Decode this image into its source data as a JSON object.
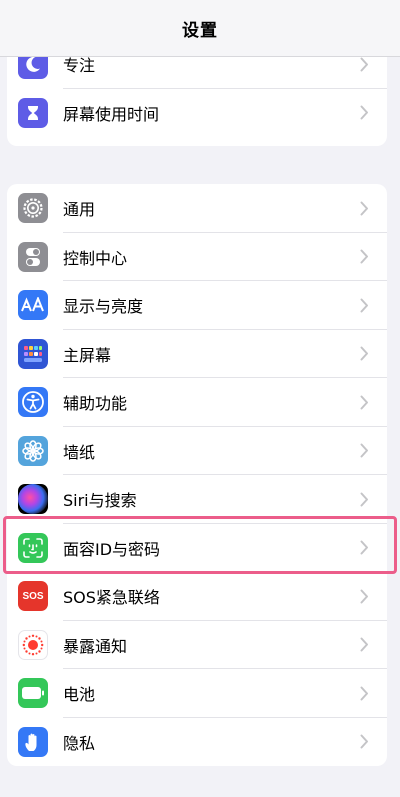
{
  "nav": {
    "title": "设置"
  },
  "group1": {
    "items": [
      {
        "label": "专注",
        "icon": "moon-icon",
        "color": "#5e5ce6"
      },
      {
        "label": "屏幕使用时间",
        "icon": "hourglass-icon",
        "color": "#5e5ce6"
      }
    ]
  },
  "group2": {
    "items": [
      {
        "label": "通用",
        "icon": "gear-icon",
        "color": "#8e8e93"
      },
      {
        "label": "控制中心",
        "icon": "toggles-icon",
        "color": "#8e8e93"
      },
      {
        "label": "显示与亮度",
        "icon": "text-size-icon",
        "color": "#3478f6"
      },
      {
        "label": "主屏幕",
        "icon": "home-screen-grid-icon",
        "color": "#3478f6"
      },
      {
        "label": "辅助功能",
        "icon": "accessibility-icon",
        "color": "#3478f6"
      },
      {
        "label": "墙纸",
        "icon": "flower-icon",
        "color": "#54a4dc"
      },
      {
        "label": "Siri与搜索",
        "icon": "siri-icon",
        "color": "#000000"
      },
      {
        "label": "面容ID与密码",
        "icon": "face-id-icon",
        "color": "#34c759"
      },
      {
        "label": "SOS紧急联络",
        "icon": "sos-icon",
        "color": "#e5352b",
        "icon_text": "SOS"
      },
      {
        "label": "暴露通知",
        "icon": "exposure-notification-icon",
        "color": "#ffffff"
      },
      {
        "label": "电池",
        "icon": "battery-icon",
        "color": "#34c759"
      },
      {
        "label": "隐私",
        "icon": "hand-icon",
        "color": "#3478f6"
      }
    ]
  },
  "highlight": {
    "color": "#ec5d8a"
  }
}
